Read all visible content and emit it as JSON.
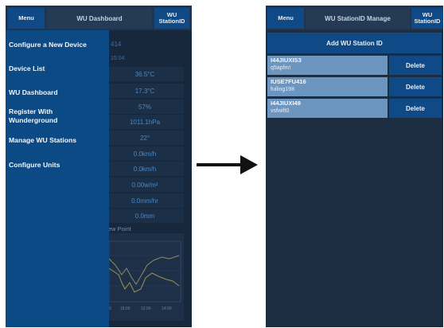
{
  "left": {
    "menu_label": "Menu",
    "title": "WU Dashboard",
    "station_label": "WU\nStationID",
    "drawer_items": [
      "Configure a New Device",
      "Device List",
      "WU Dashboard",
      "Register With Wunderground",
      "Manage WU Stations",
      "Configure Units"
    ],
    "dashboard_values": [
      "414",
      "15:04",
      "36.5°C",
      "17.3°C",
      "57%",
      "1011.1hPa",
      "22°",
      "0.0km/h",
      "0.0km/h",
      "0.00w/m²",
      "0.0mm/hr",
      "0.0mm"
    ],
    "chart_title": "ew Point",
    "chart_ticks": [
      "0",
      "15:00",
      "12:00",
      "14:00"
    ]
  },
  "right": {
    "menu_label": "Menu",
    "title": "WU StationID Manage",
    "station_label": "WU\nStationID",
    "add_label": "Add WU Station ID",
    "stations": [
      {
        "id": "I44JIUXIS3",
        "pass": "q5apfm!"
      },
      {
        "id": "IUSE7FU416",
        "pass": "fuiling198"
      },
      {
        "id": "I44JIUXI49",
        "pass": "vsfwift0"
      }
    ],
    "delete_label": "Delete"
  },
  "colors": {
    "drawer": "#0c4a86",
    "button": "#0f4a86",
    "row": "#6c95bf",
    "background": "#17283c",
    "chart_line_a": "#8e8a6c",
    "chart_line_b": "#9b8f55"
  }
}
